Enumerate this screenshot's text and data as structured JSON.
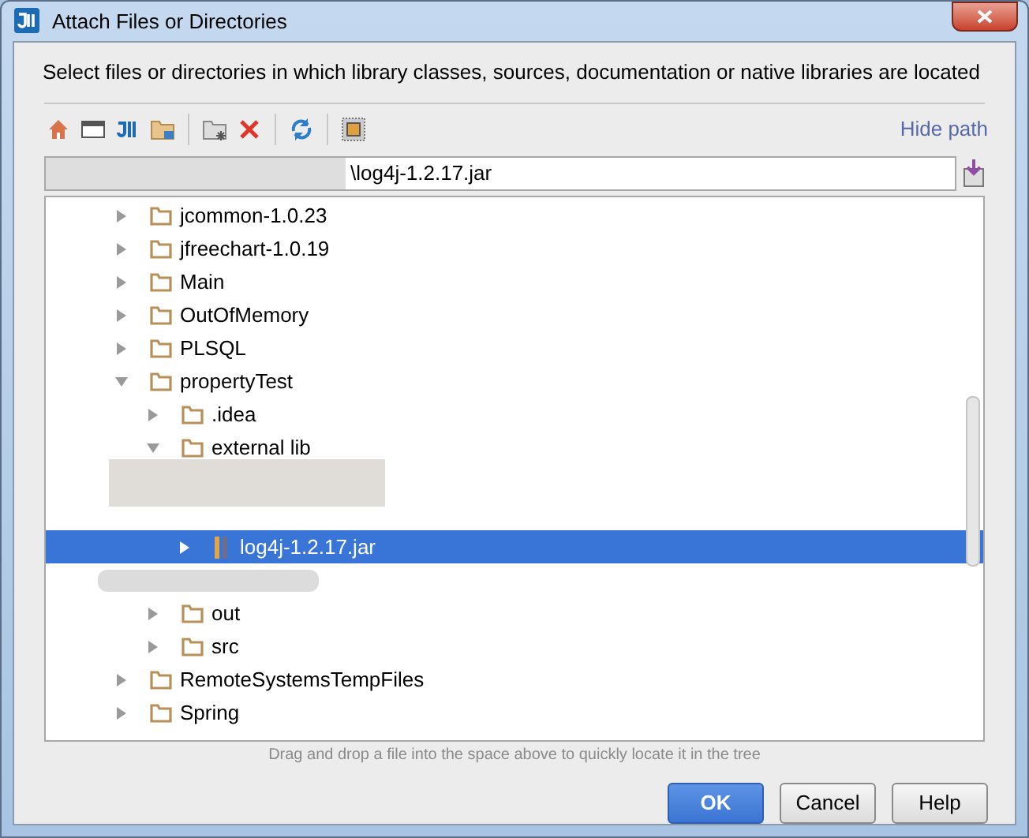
{
  "window": {
    "title": "Attach Files or Directories"
  },
  "description": "Select files or directories in which library classes, sources, documentation or native libraries are located",
  "toolbar": {
    "hide_path_link": "Hide path"
  },
  "path_field": {
    "value": "\\log4j-1.2.17.jar"
  },
  "tree": [
    {
      "label": "jcommon-1.0.23",
      "kind": "folder",
      "expanded": false
    },
    {
      "label": "jfreechart-1.0.19",
      "kind": "folder",
      "expanded": false
    },
    {
      "label": "Main",
      "kind": "folder",
      "expanded": false
    },
    {
      "label": "OutOfMemory",
      "kind": "folder",
      "expanded": false
    },
    {
      "label": "PLSQL",
      "kind": "folder",
      "expanded": false
    },
    {
      "label": "propertyTest",
      "kind": "folder",
      "expanded": true,
      "children": [
        {
          "label": ".idea",
          "kind": "folder",
          "expanded": false
        },
        {
          "label": "external lib",
          "kind": "folder",
          "expanded": true,
          "children": [
            {
              "label": "log4j-1.2.17.jar",
              "kind": "jar",
              "expanded": false,
              "selected": true
            }
          ]
        },
        {
          "label": "out",
          "kind": "folder",
          "expanded": false
        },
        {
          "label": "src",
          "kind": "folder",
          "expanded": false
        }
      ]
    },
    {
      "label": "RemoteSystemsTempFiles",
      "kind": "folder",
      "expanded": false
    },
    {
      "label": "Spring",
      "kind": "folder",
      "expanded": false
    }
  ],
  "hint": "Drag and drop a file into the space above to quickly locate it in the tree",
  "buttons": [
    {
      "label": "OK",
      "default": true
    },
    {
      "label": "Cancel",
      "default": false
    },
    {
      "label": "Help",
      "default": false
    }
  ]
}
